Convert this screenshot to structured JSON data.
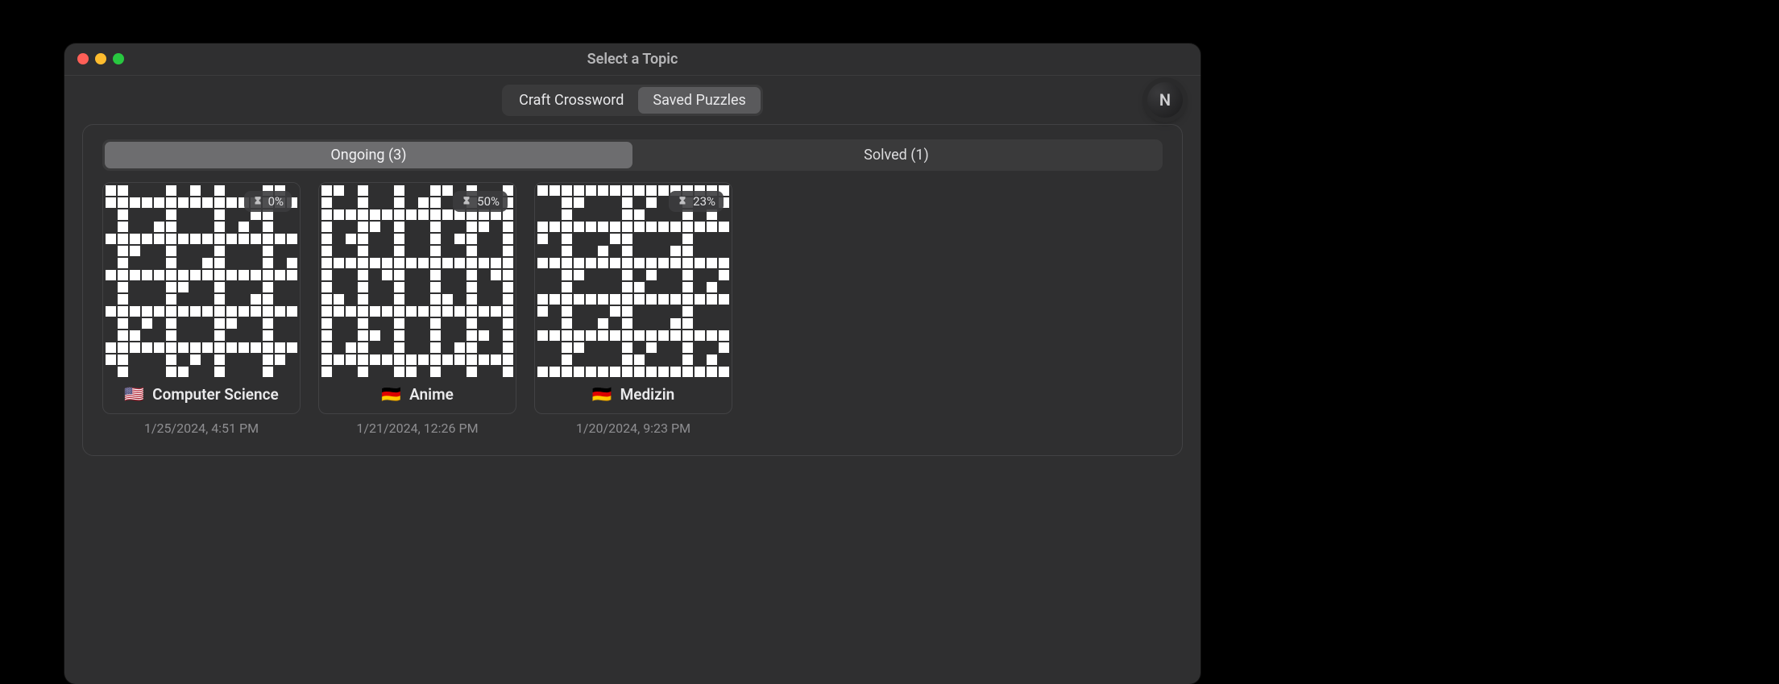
{
  "window": {
    "title": "Select a Topic"
  },
  "header": {
    "segments": [
      {
        "label": "Craft Crossword",
        "active": false
      },
      {
        "label": "Saved Puzzles",
        "active": true
      }
    ],
    "avatar_initial": "N"
  },
  "tabs": {
    "ongoing": {
      "label": "Ongoing (3)",
      "active": true
    },
    "solved": {
      "label": "Solved (1)",
      "active": false
    }
  },
  "puzzles": [
    {
      "flag": "🇺🇸",
      "title": "Computer Science",
      "progress": "0%",
      "timestamp": "1/25/2024, 4:51 PM"
    },
    {
      "flag": "🇩🇪",
      "title": "Anime",
      "progress": "50%",
      "timestamp": "1/21/2024, 12:26 PM"
    },
    {
      "flag": "🇩🇪",
      "title": "Medizin",
      "progress": "23%",
      "timestamp": "1/20/2024, 9:23 PM"
    }
  ]
}
